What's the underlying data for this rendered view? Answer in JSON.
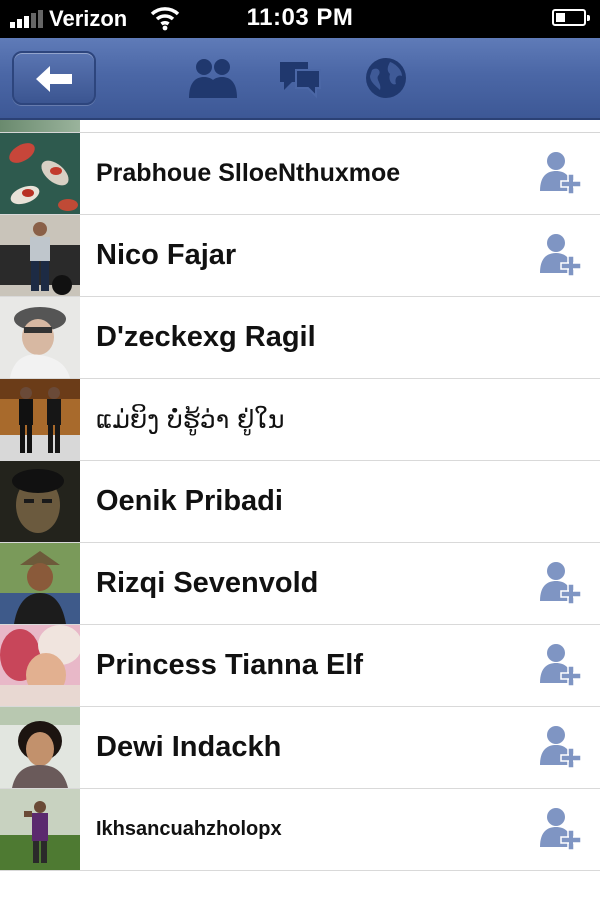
{
  "status_bar": {
    "carrier": "Verizon",
    "time": "11:03 PM"
  },
  "nav": {
    "back_icon": "back-arrow-icon",
    "tabs": [
      {
        "icon": "friend-requests-icon"
      },
      {
        "icon": "messages-icon"
      },
      {
        "icon": "notifications-globe-icon"
      }
    ]
  },
  "colors": {
    "navbar": "#4b67a6",
    "icon_blue": "#20386e",
    "add_friend": "#7f95c3"
  },
  "people": [
    {
      "name": "Prabhoue SlloeNthuxmoe",
      "add_friend": true,
      "photo": "koi-fish"
    },
    {
      "name": "Nico Fajar",
      "add_friend": true,
      "photo": "man-by-car"
    },
    {
      "name": "D'zeckexg Ragil",
      "add_friend": false,
      "photo": "selfie-cap"
    },
    {
      "name": "ແມ່ຍິງ ບໍ່ຮູ້ວ່າ ຢູ່ໃນ",
      "add_friend": false,
      "photo": "group-dark"
    },
    {
      "name": "Oenik Pribadi",
      "add_friend": false,
      "photo": "portrait-dark"
    },
    {
      "name": "Rizqi Sevenvold",
      "add_friend": true,
      "photo": "man-hat-outdoor"
    },
    {
      "name": "Princess Tianna Elf",
      "add_friend": true,
      "photo": "pink-blur"
    },
    {
      "name": "Dewi Indackh",
      "add_friend": true,
      "photo": "girl-portrait"
    },
    {
      "name": "Ikhsancuahzholopx",
      "add_friend": true,
      "photo": "man-on-grass"
    }
  ]
}
